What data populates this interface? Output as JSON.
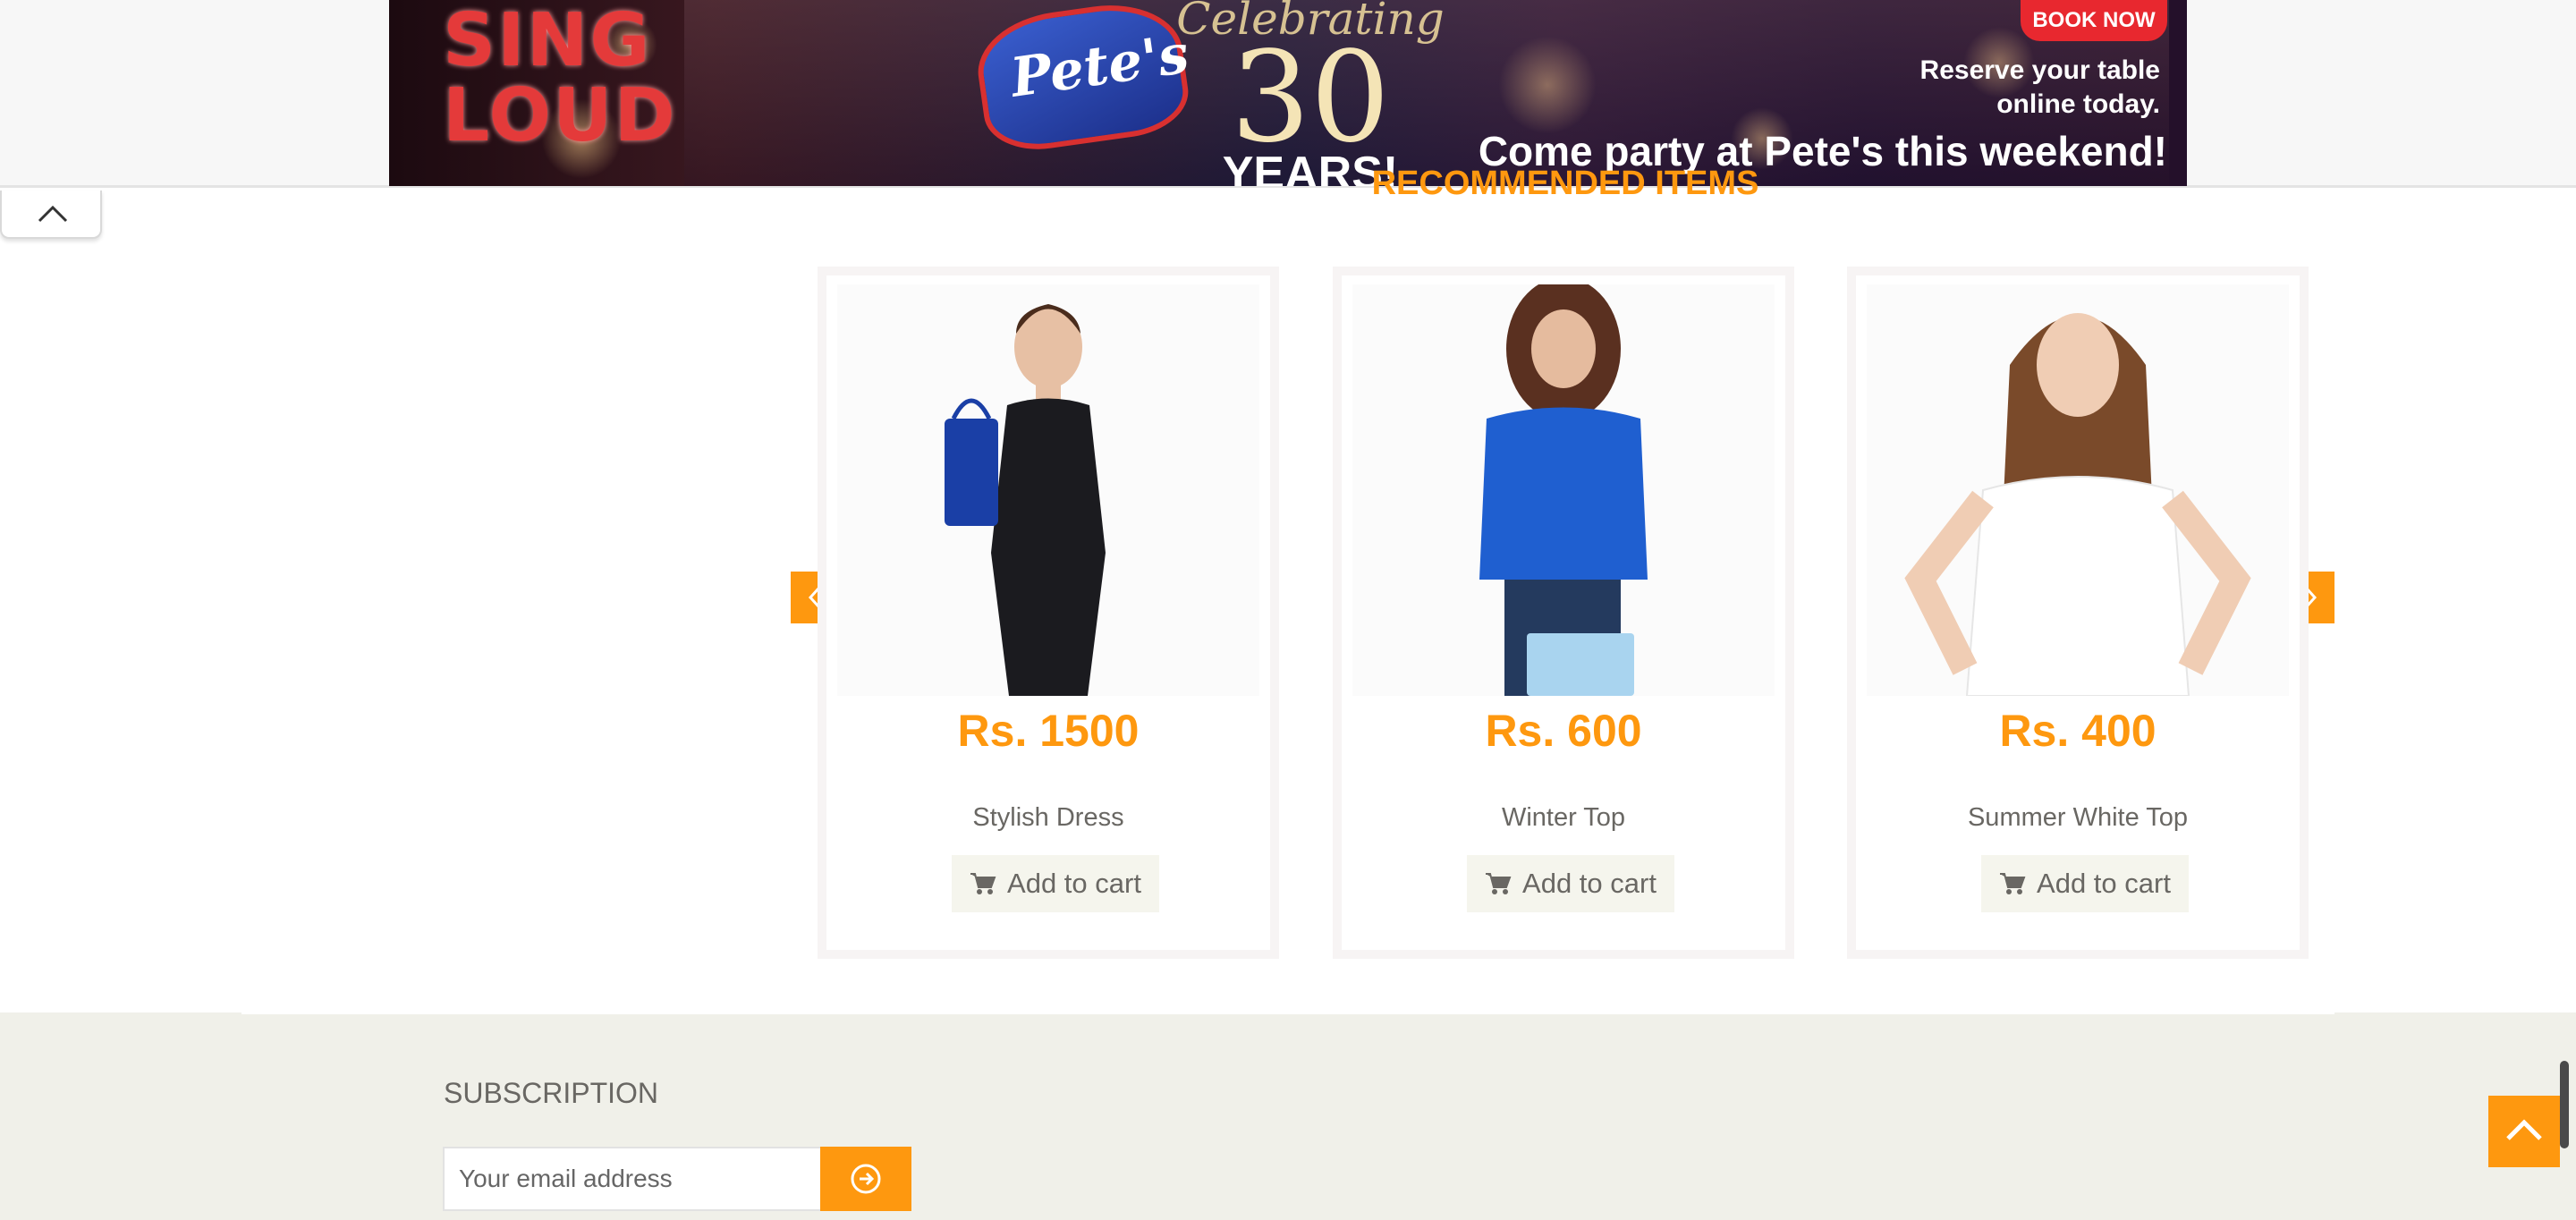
{
  "ad": {
    "sing_loud": "SING LOUD",
    "logo_text": "Pete's",
    "celebrating": "Celebrating",
    "years_number": "30",
    "years_label": "YEARS!",
    "book_now": "BOOK NOW",
    "reserve_line1": "Reserve your table",
    "reserve_line2": "online today.",
    "party": "Come party at Pete's this weekend!"
  },
  "recommended": {
    "title": "Recommended Items"
  },
  "products": [
    {
      "price": "Rs. 1500",
      "name": "Stylish Dress",
      "cart_label": "Add to cart",
      "color_top": "#1b1b1f",
      "accent": "#1a3fa6"
    },
    {
      "price": "Rs. 600",
      "name": "Winter Top",
      "cart_label": "Add to cart",
      "color_top": "#1f5fd0",
      "accent": "#a9d4ef"
    },
    {
      "price": "Rs. 400",
      "name": "Summer White Top",
      "cart_label": "Add to cart",
      "color_top": "#ffffff",
      "accent": "#7a4a2a"
    }
  ],
  "footer": {
    "subscription_title": "SUBSCRIPTION",
    "email_placeholder": "Your email address"
  },
  "colors": {
    "accent": "#FE980F",
    "text": "#696763",
    "footer_bg": "#F0F0E9"
  }
}
